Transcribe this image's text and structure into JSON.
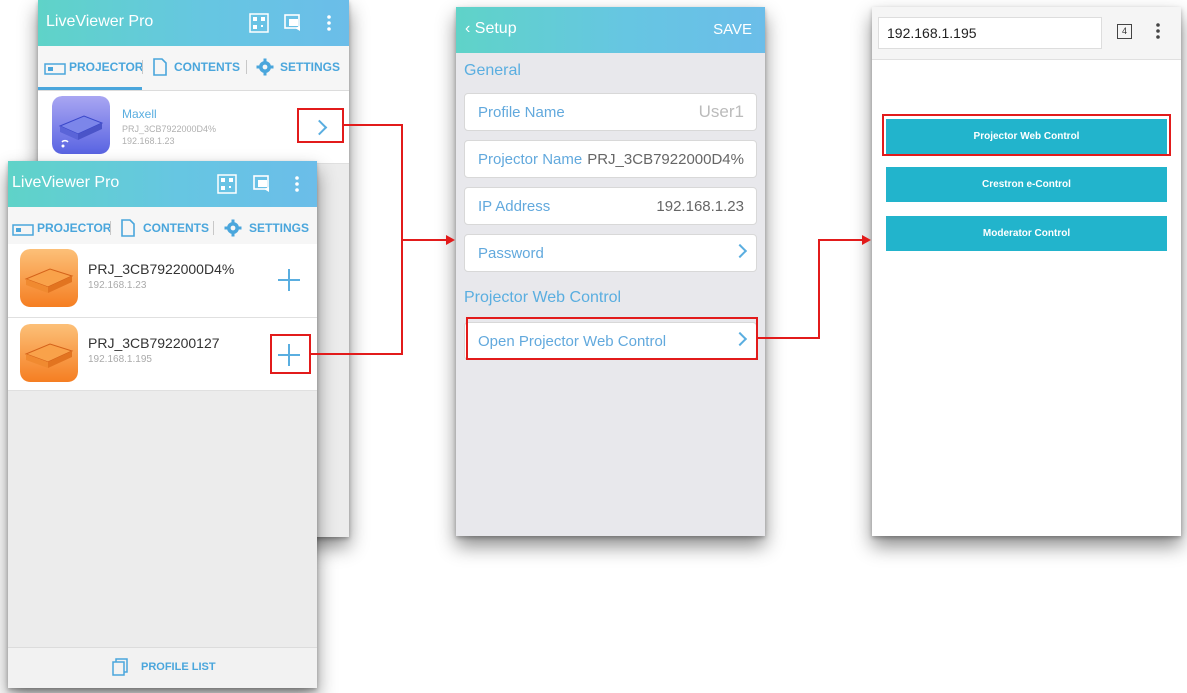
{
  "back_phone": {
    "app_title": "LiveViewer Pro",
    "tabs": {
      "projector": "PROJECTOR",
      "contents": "CONTENTS",
      "settings": "SETTINGS"
    },
    "item": {
      "name": "Maxell",
      "id": "PRJ_3CB7922000D4%",
      "ip": "192.168.1.23"
    }
  },
  "front_phone": {
    "app_title": "LiveViewer Pro",
    "tabs": {
      "projector": "PROJECTOR",
      "contents": "CONTENTS",
      "settings": "SETTINGS"
    },
    "items": [
      {
        "name": "PRJ_3CB7922000D4%",
        "ip": "192.168.1.23"
      },
      {
        "name": "PRJ_3CB792200127",
        "ip": "192.168.1.195"
      }
    ],
    "footer": {
      "label": "PROFILE LIST"
    }
  },
  "setup": {
    "back_label": "Setup",
    "save_label": "SAVE",
    "general_section": "General",
    "fields": [
      {
        "label": "Profile Name",
        "value": "User1"
      },
      {
        "label": "Projector Name",
        "value": "PRJ_3CB7922000D4%"
      },
      {
        "label": "IP Address",
        "value": "192.168.1.23"
      },
      {
        "label": "Password",
        "value": ""
      }
    ],
    "web_section": "Projector Web Control",
    "open_web": "Open Projector Web Control"
  },
  "browser": {
    "url": "192.168.1.195",
    "tab_count": "4",
    "buttons": [
      "Projector Web Control",
      "Crestron e-Control",
      "Moderator Control"
    ]
  },
  "colors": {
    "accent": "#4aa6dc",
    "highlight": "#e21b1b",
    "web_button": "#22b4cc",
    "projector_icon_orange": "#f79a3c",
    "projector_icon_purple": "#6f79e8"
  }
}
